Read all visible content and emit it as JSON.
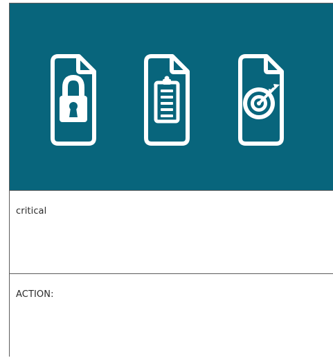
{
  "banner": {
    "background_color": "#08657c",
    "icons": [
      "lock-document-icon",
      "clipboard-document-icon",
      "target-document-icon"
    ],
    "icon_color": "#ffffff"
  },
  "sections": {
    "critical": {
      "label": "critical"
    },
    "action": {
      "label": "ACTION:"
    }
  }
}
